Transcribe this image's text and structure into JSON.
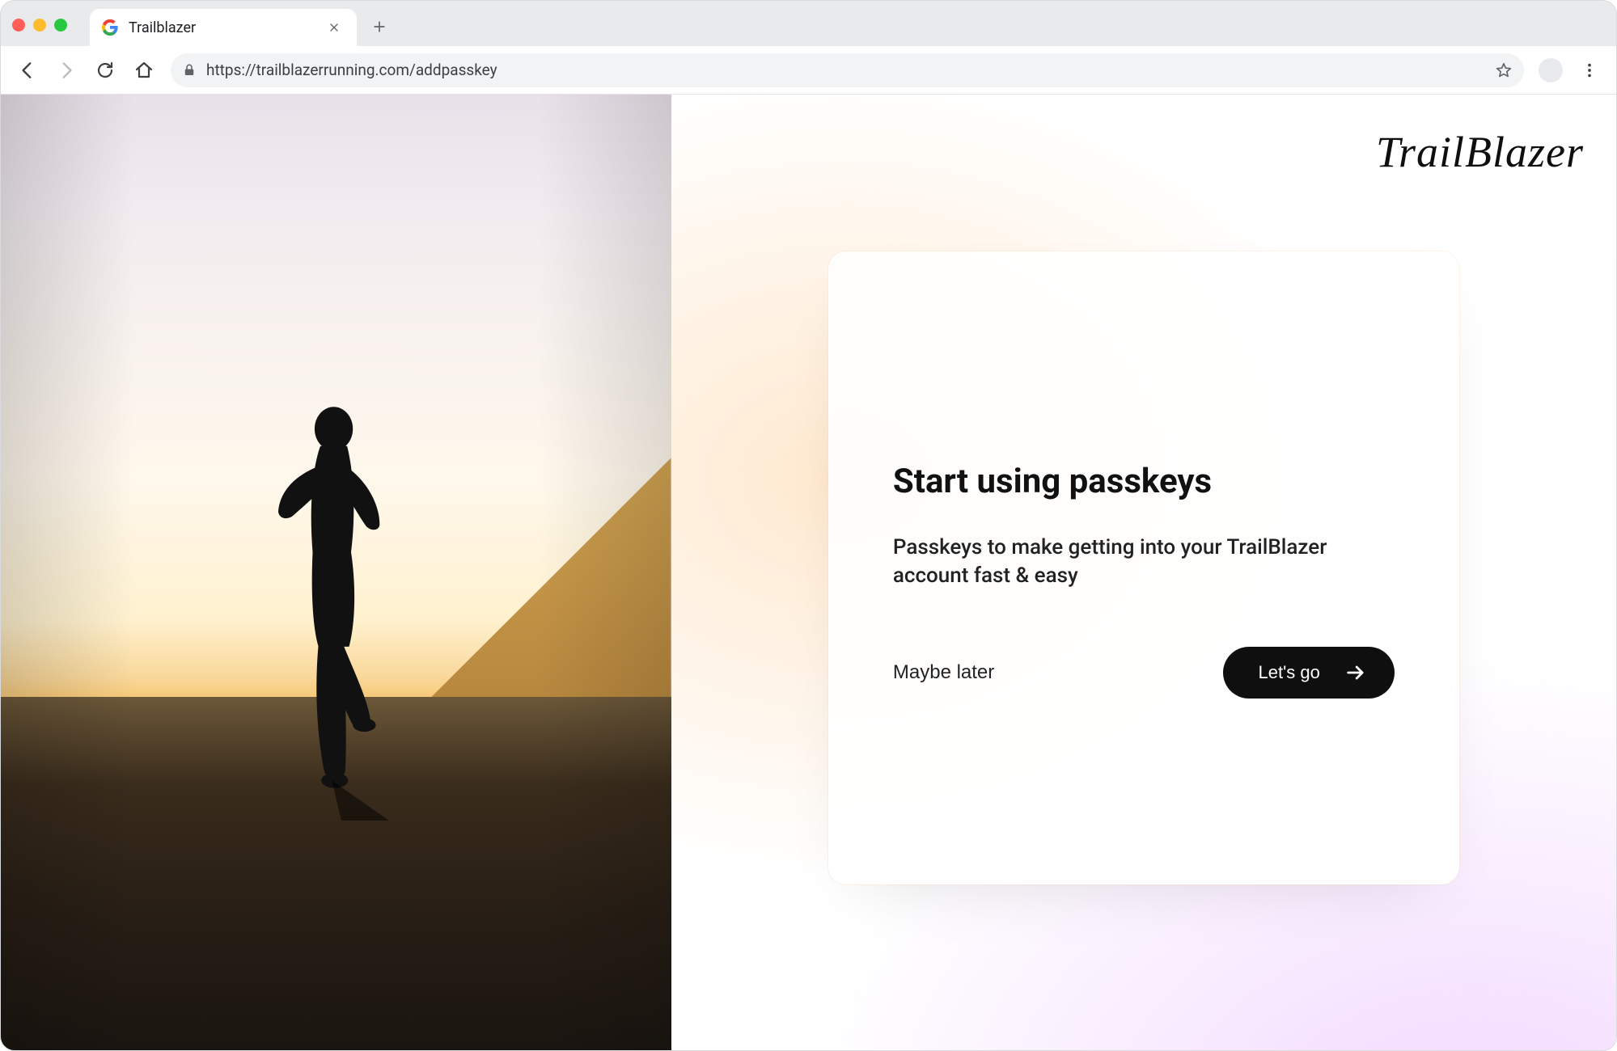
{
  "browser": {
    "tab_title": "Trailblazer",
    "url": "https://trailblazerrunning.com/addpasskey"
  },
  "page": {
    "brand": "TrailBlazer",
    "heading": "Start using passkeys",
    "subheading": "Passkeys to make getting into your TrailBlazer account fast & easy",
    "maybe_later": "Maybe later",
    "lets_go": "Let's go"
  }
}
